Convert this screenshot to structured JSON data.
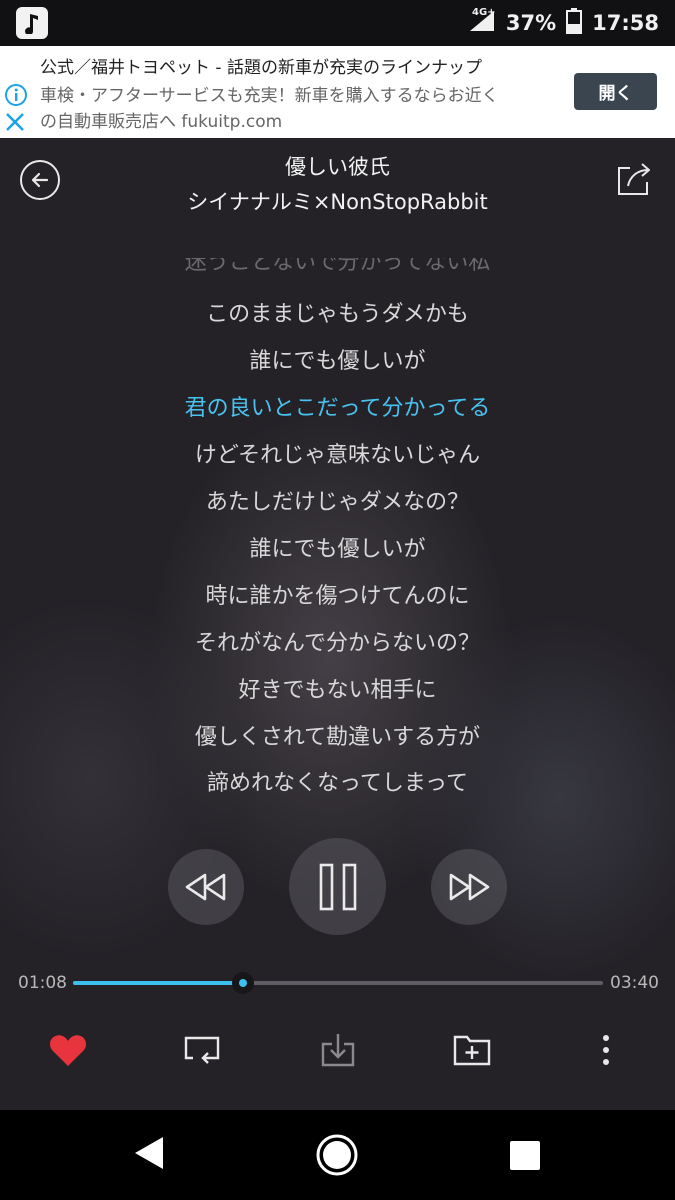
{
  "status_bar": {
    "network": "4G+",
    "battery": "37%",
    "time": "17:58"
  },
  "ad": {
    "line1": "公式／福井トヨペット - 話題の新車が充実のラインナップ",
    "line2": "車検・アフターサービスも充実！新車を購入するならお近く",
    "line3": "の自動車販売店へ fukuitp.com",
    "button": "開く"
  },
  "song": {
    "title": "優しい彼氏",
    "artist": "シイナナルミ×NonStopRabbit"
  },
  "lyrics": {
    "partial_top": "迷うことないで分かってない私",
    "lines": [
      "このままじゃもうダメかも",
      "誰にでも優しいが",
      "君の良いとこだって分かってる",
      "けどそれじゃ意味ないじゃん",
      "あたしだけじゃダメなの？",
      "誰にでも優しいが",
      "時に誰かを傷つけてんのに",
      "それがなんで分からないの？",
      "好きでもない相手に",
      "優しくされて勘違いする方が",
      "諦めれなくなってしまって"
    ],
    "active_index": 2
  },
  "progress": {
    "current": "01:08",
    "total": "03:40",
    "fraction": 0.32
  },
  "colors": {
    "accent": "#3cc0ee",
    "heart": "#e8343c"
  }
}
